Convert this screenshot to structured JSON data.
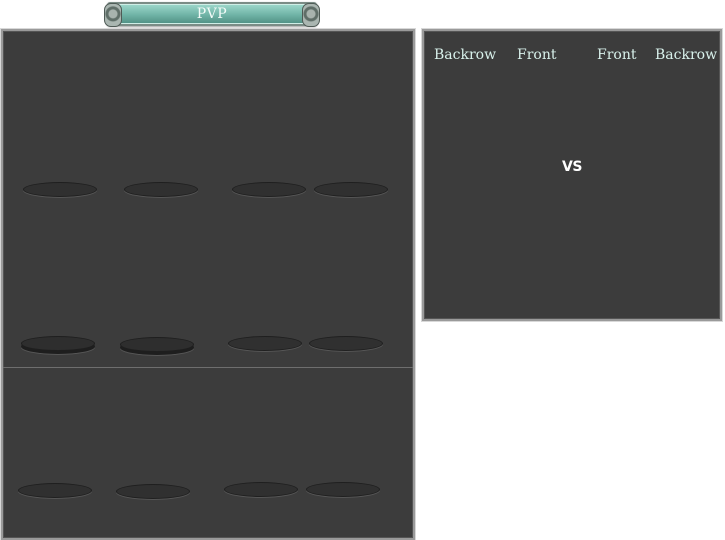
{
  "header": {
    "title": "PVP"
  },
  "vs_panel": {
    "columns": [
      {
        "label": "Backrow"
      },
      {
        "label": "Front"
      },
      {
        "label": "Front"
      },
      {
        "label": "Backrow"
      }
    ],
    "vs_text": "VS"
  },
  "colors": {
    "panel_bg": "#3c3c3c",
    "panel_border": "#9a9a9a",
    "banner_accent": "#6fb3a6",
    "label_text": "#d9f2ec"
  }
}
